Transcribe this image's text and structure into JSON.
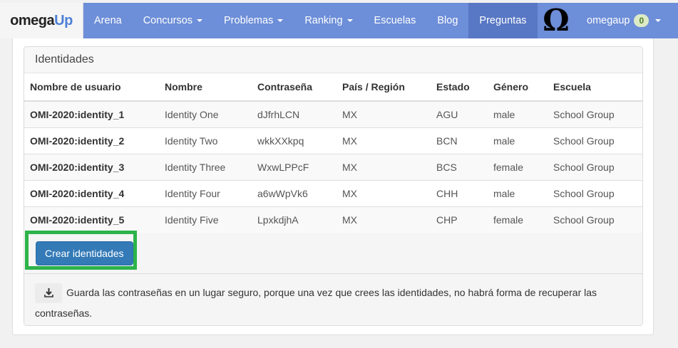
{
  "navbar": {
    "brand_part1": "omega",
    "brand_part2": "Up",
    "items": [
      {
        "label": "Arena",
        "dropdown": false,
        "active": false
      },
      {
        "label": "Concursos",
        "dropdown": true,
        "active": false
      },
      {
        "label": "Problemas",
        "dropdown": true,
        "active": false
      },
      {
        "label": "Ranking",
        "dropdown": true,
        "active": false
      },
      {
        "label": "Escuelas",
        "dropdown": false,
        "active": false
      },
      {
        "label": "Blog",
        "dropdown": false,
        "active": false
      },
      {
        "label": "Preguntas",
        "dropdown": false,
        "active": true
      }
    ],
    "user": {
      "avatar_glyph": "Ω",
      "name": "omegaup",
      "badge": "0"
    },
    "colors": {
      "bar": "#6d8ed8",
      "active": "#5877c4"
    }
  },
  "identities": {
    "title": "Identidades",
    "columns": [
      "Nombre de usuario",
      "Nombre",
      "Contraseña",
      "País / Región",
      "Estado",
      "Género",
      "Escuela"
    ],
    "rows": [
      [
        "OMI-2020:identity_1",
        "Identity One",
        "dJfrhLCN",
        "MX",
        "AGU",
        "male",
        "School Group"
      ],
      [
        "OMI-2020:identity_2",
        "Identity Two",
        "wkkXXkpq",
        "MX",
        "BCN",
        "male",
        "School Group"
      ],
      [
        "OMI-2020:identity_3",
        "Identity Three",
        "WxwLPPcF",
        "MX",
        "BCS",
        "female",
        "School Group"
      ],
      [
        "OMI-2020:identity_4",
        "Identity Four",
        "a6wWpVk6",
        "MX",
        "CHH",
        "male",
        "School Group"
      ],
      [
        "OMI-2020:identity_5",
        "Identity Five",
        "LpxkdjhA",
        "MX",
        "CHP",
        "female",
        "School Group"
      ]
    ],
    "create_button": "Crear identidades",
    "note": "Guarda las contraseñas en un lugar seguro, porque una vez que crees las identidades, no habrá forma de recuperar las contraseñas.",
    "note_icon": "download-icon",
    "highlight_color": "#2db34a"
  }
}
